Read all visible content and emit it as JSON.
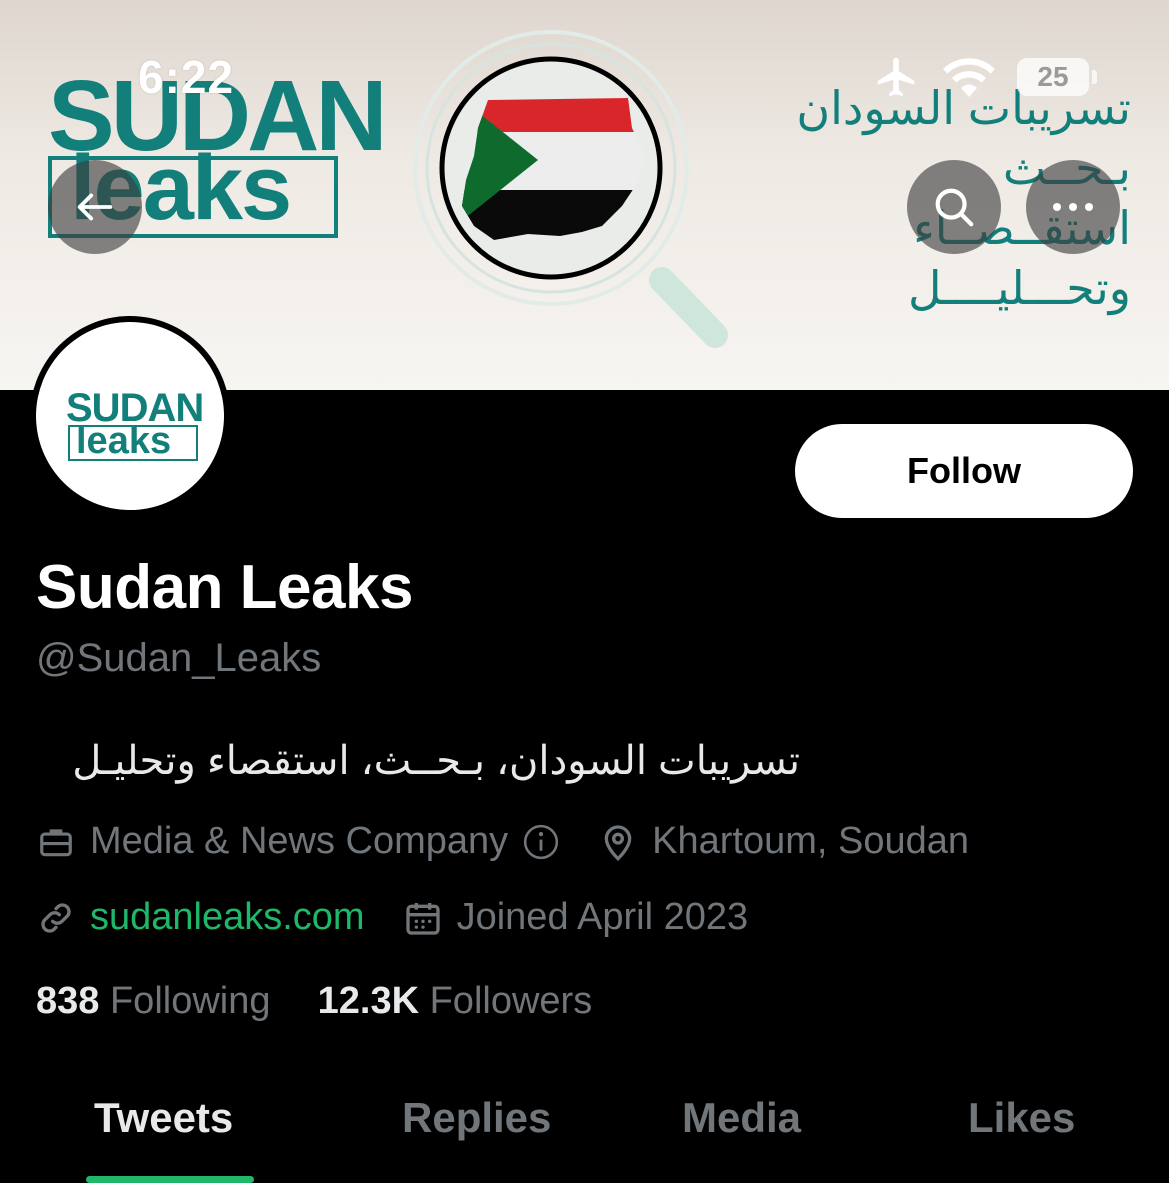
{
  "status_bar": {
    "time": "6:22",
    "battery": "25"
  },
  "banner": {
    "brand_top": "SUDAN",
    "brand_bottom": "leaks",
    "arabic_lines": [
      "تسريبات السودان",
      "بـحــث",
      "استقــصــاء",
      "وتحـــليــــل"
    ],
    "accent_color": "#137f7b"
  },
  "header": {
    "back_icon": "arrow-left-icon",
    "search_icon": "search-icon",
    "more_icon": "more-dots-icon"
  },
  "profile": {
    "avatar_top": "SUDAN",
    "avatar_bottom": "leaks",
    "name": "Sudan Leaks",
    "handle": "@Sudan_Leaks",
    "bio": "تسريبات السودان، بـحــث، استقصاء وتحليـل",
    "category": "Media & News Company",
    "location": "Khartoum, Soudan",
    "website": "sudanleaks.com",
    "joined": "Joined April 2023",
    "follow_label": "Follow",
    "link_color": "#1fb86a"
  },
  "stats": {
    "following_count": "838",
    "following_label": "Following",
    "followers_count": "12.3K",
    "followers_label": "Followers"
  },
  "tabs": [
    {
      "label": "Tweets",
      "active": true
    },
    {
      "label": "Replies",
      "active": false
    },
    {
      "label": "Media",
      "active": false
    },
    {
      "label": "Likes",
      "active": false
    }
  ]
}
